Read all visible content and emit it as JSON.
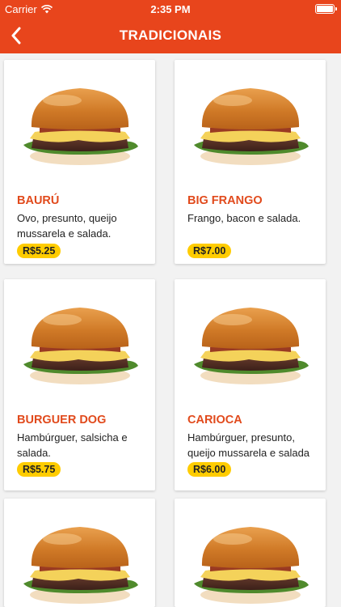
{
  "status_bar": {
    "carrier": "Carrier",
    "time": "2:35 PM",
    "wifi_icon": "wifi-icon",
    "battery_icon": "battery-icon"
  },
  "nav": {
    "title": "TRADICIONAIS",
    "back_icon": "chevron-left-icon"
  },
  "colors": {
    "brand": "#e8451c",
    "name_text": "#e14a1c",
    "price_badge": "#ffcc00"
  },
  "products": [
    {
      "name": "BAURÚ",
      "description": "Ovo, presunto, queijo mussarela e salada.",
      "price": "R$5.25"
    },
    {
      "name": "BIG FRANGO",
      "description": "Frango, bacon e salada.",
      "price": "R$7.00"
    },
    {
      "name": "BURGUER DOG",
      "description": "Hambúrguer, salsicha e salada.",
      "price": "R$5.75"
    },
    {
      "name": "CARIOCA",
      "description": "Hambúrguer, presunto, queijo mussarela e salada",
      "price": "R$6.00"
    },
    {
      "name": "",
      "description": "",
      "price": ""
    },
    {
      "name": "",
      "description": "",
      "price": ""
    }
  ]
}
